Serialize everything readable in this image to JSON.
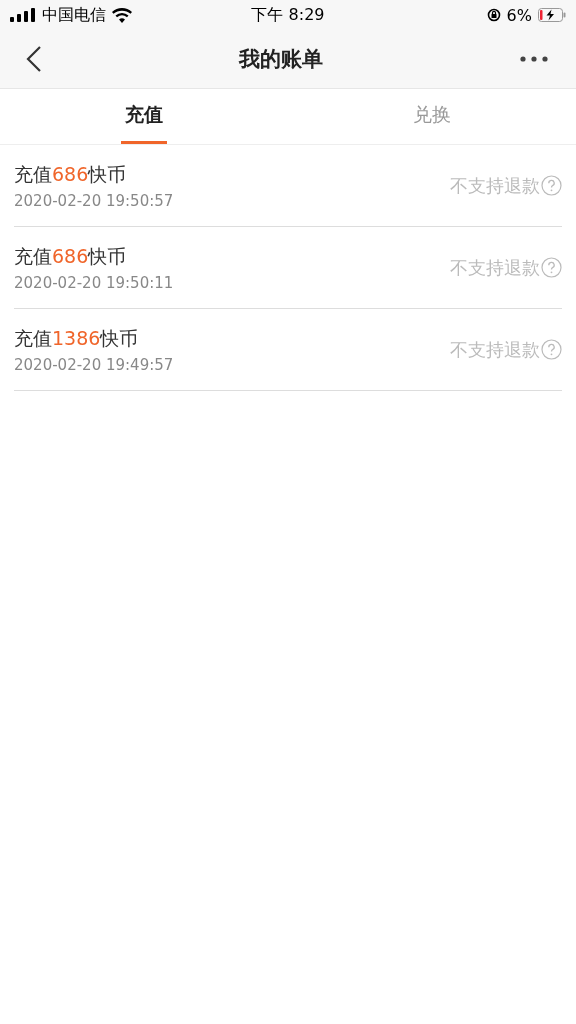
{
  "status_bar": {
    "carrier": "中国电信",
    "time": "下午 8:29",
    "battery": "6%"
  },
  "nav": {
    "title": "我的账单"
  },
  "tabs": [
    {
      "label": "充值",
      "selected": true
    },
    {
      "label": "兑换",
      "selected": false
    }
  ],
  "records": [
    {
      "prefix": "充值",
      "amount": "686",
      "suffix": "快币",
      "time": "2020-02-20 19:50:57",
      "note": "不支持退款"
    },
    {
      "prefix": "充值",
      "amount": "686",
      "suffix": "快币",
      "time": "2020-02-20 19:50:11",
      "note": "不支持退款"
    },
    {
      "prefix": "充值",
      "amount": "1386",
      "suffix": "快币",
      "time": "2020-02-20 19:49:57",
      "note": "不支持退款"
    }
  ]
}
